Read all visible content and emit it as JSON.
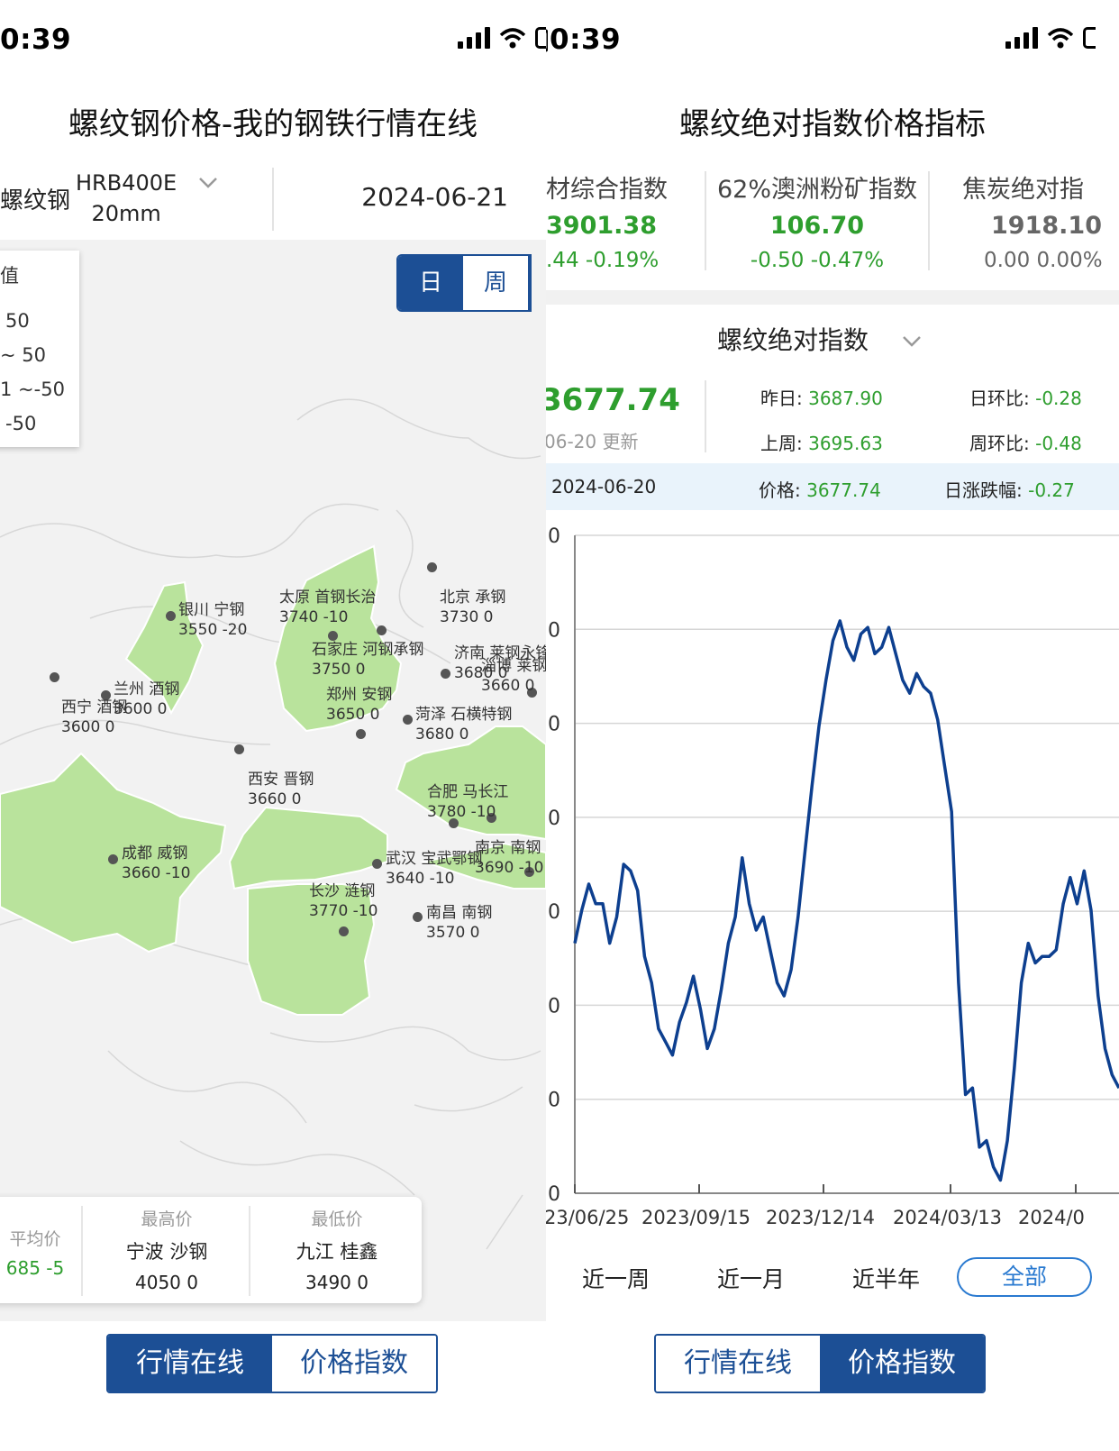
{
  "left": {
    "status_time": "0:39",
    "title": "螺纹钢价格-我的钢铁行情在线",
    "product": "螺纹钢",
    "spec_line1": "HRB400E",
    "spec_line2": "20mm",
    "date": "2024-06-21",
    "legend": {
      "title": "值",
      "r1": "50",
      "r2": "~ 50",
      "r3": "1 ~-50",
      "r4": "-50"
    },
    "period": {
      "day": "日",
      "week": "周"
    },
    "cities": [
      {
        "name": "银川 宁钢",
        "val": "3550  -20"
      },
      {
        "name": "太原 首钢长治",
        "val": "3740  -10"
      },
      {
        "name": "北京 承钢",
        "val": "3730   0"
      },
      {
        "name": "石家庄 河钢承钢",
        "val": "3750   0"
      },
      {
        "name": "济南 莱钢永锋",
        "val": "3680   0"
      },
      {
        "name": "淄博 莱钢",
        "val": "3660  0"
      },
      {
        "name": "兰州 酒钢",
        "val": "3600   0"
      },
      {
        "name": "西宁 酒钢",
        "val": "3600   0"
      },
      {
        "name": "郑州 安钢",
        "val": "3650   0"
      },
      {
        "name": "菏泽 石横特钢",
        "val": "3680   0"
      },
      {
        "name": "西安 晋钢",
        "val": "3660   0"
      },
      {
        "name": "合肥 马长江",
        "val": "3780   -10"
      },
      {
        "name": "成都 威钢",
        "val": "3660   -10"
      },
      {
        "name": "武汉 宝武鄂钢",
        "val": "3640   -10"
      },
      {
        "name": "南京 南钢",
        "val": "3690   -10"
      },
      {
        "name": "长沙 涟钢",
        "val": "3770   -10"
      },
      {
        "name": "南昌 南钢",
        "val": "3570   0"
      }
    ],
    "stats": {
      "avg_label": "平均价",
      "avg_value": "685 -5",
      "high_label": "最高价",
      "high_name": "宁波 沙钢",
      "high_value": "4050 0",
      "low_label": "最低价",
      "low_name": "九江 桂鑫",
      "low_value": "3490 0"
    },
    "tabs": {
      "market": "行情在线",
      "index": "价格指数"
    }
  },
  "right": {
    "status_time": "0:39",
    "title": "螺纹绝对指数价格指标",
    "indices": [
      {
        "name": "材综合指数",
        "value": "3901.38",
        "change": ".44 -0.19%"
      },
      {
        "name": "62%澳洲粉矿指数",
        "value": "106.70",
        "change": "-0.50 -0.47%"
      },
      {
        "name": "焦炭绝对指",
        "value": "1918.10",
        "change": "0.00 0.00%"
      }
    ],
    "selector": "螺纹绝对指数",
    "current": "3677.74",
    "updated": "06-20 更新",
    "yesterday_label": "昨日:",
    "yesterday": "3687.90",
    "lastweek_label": "上周:",
    "lastweek": "3695.63",
    "dod_label": "日环比:",
    "dod": "-0.28",
    "wow_label": "周环比:",
    "wow": "-0.48",
    "sel_date": "2024-06-20",
    "sel_price_label": "价格:",
    "sel_price": "3677.74",
    "sel_change_label": "日涨跌幅:",
    "sel_change": "-0.27",
    "ranges": [
      "近一周",
      "近一月",
      "近半年",
      "全部"
    ],
    "tabs": {
      "market": "行情在线",
      "index": "价格指数"
    }
  },
  "chart_data": {
    "type": "line",
    "x_ticks": [
      "23/06/25",
      "2023/09/15",
      "2023/12/14",
      "2024/03/13",
      "2024/0"
    ],
    "y_tick_labels": [
      "0",
      "0",
      "0",
      "0",
      "0",
      "0",
      "0",
      "0"
    ],
    "series": [
      {
        "values": [
          3.8,
          4.3,
          4.7,
          4.4,
          4.4,
          3.8,
          4.2,
          5.0,
          4.9,
          4.6,
          3.6,
          3.2,
          2.5,
          2.3,
          2.1,
          2.6,
          2.9,
          3.3,
          2.8,
          2.2,
          2.5,
          3.1,
          3.8,
          4.2,
          5.1,
          4.4,
          4.0,
          4.2,
          3.7,
          3.2,
          3.0,
          3.4,
          4.2,
          5.2,
          6.2,
          7.1,
          7.8,
          8.4,
          8.7,
          8.3,
          8.1,
          8.5,
          8.6,
          8.2,
          8.3,
          8.6,
          8.2,
          7.8,
          7.6,
          7.9,
          7.7,
          7.6,
          7.2,
          6.5,
          5.8,
          3.2,
          1.5,
          1.6,
          0.7,
          0.8,
          0.4,
          0.2,
          0.8,
          1.9,
          3.2,
          3.8,
          3.5,
          3.6,
          3.6,
          3.7,
          4.4,
          4.8,
          4.4,
          4.9,
          4.3,
          3.0,
          2.2,
          1.8,
          1.6
        ]
      }
    ],
    "ylim": [
      0,
      10
    ]
  }
}
